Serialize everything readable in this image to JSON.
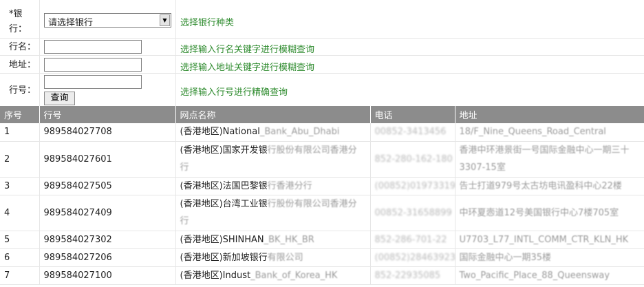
{
  "form": {
    "bank": {
      "label_star": "*银",
      "label_rest": "行：",
      "selected": "请选择银行",
      "hint": "选择银行种类"
    },
    "branch_name": {
      "label": "行名：",
      "value": "",
      "hint": "选择输入行名关键字进行模糊查询"
    },
    "address": {
      "label": "地址：",
      "value": "",
      "hint": "选择输入地址关键字进行模糊查询"
    },
    "bank_no": {
      "label": "行号：",
      "value": "",
      "hint": "选择输入行号进行精确查询"
    },
    "search_label": "查询"
  },
  "table": {
    "headers": [
      "序号",
      "行号",
      "网点名称",
      "电话",
      "地址"
    ],
    "rows": [
      {
        "idx": "1",
        "code": "989584027708",
        "name_a": "(香港地区)National",
        "name_b": "_Bank_Abu_Dhabi",
        "phone": "00852-3413456",
        "addr_a": "18/F_Nine_Queens_Road_Central",
        "addr_b": ""
      },
      {
        "idx": "2",
        "code": "989584027601",
        "name_a": "(香港地区)国家开发银",
        "name_b": "行股份有限公司香港分行",
        "phone": "852-280-162-180",
        "addr_a": "香港中环港景街一号国际金融中心一期三十",
        "addr_b": "3307-15室"
      },
      {
        "idx": "3",
        "code": "989584027505",
        "name_a": "(香港地区)法国巴黎银",
        "name_b": "行香港分行",
        "phone": "(00852)01973319",
        "addr_a": "告士打道979号太古坊电讯盈科中心22楼",
        "addr_b": ""
      },
      {
        "idx": "4",
        "code": "989584027409",
        "name_a": "(香港地区)台湾工业银",
        "name_b": "行股份有限公司香港分行",
        "phone": "00852-31658899",
        "addr_a": "中环夏悫道12号美国银行中心7楼705室",
        "addr_b": ""
      },
      {
        "idx": "5",
        "code": "989584027302",
        "name_a": "(香港地区)SHINHAN",
        "name_b": "_BK_HK_BR",
        "phone": "852-286-701-22",
        "addr_a": "U7703_L77_INTL_COMM_CTR_KLN_HK",
        "addr_b": ""
      },
      {
        "idx": "6",
        "code": "989584027206",
        "name_a": "(香港地区)新加坡银行",
        "name_b": "有限公司",
        "phone": "(00852)28463923",
        "addr_a": "国际金融中心一期35楼",
        "addr_b": ""
      },
      {
        "idx": "7",
        "code": "989584027100",
        "name_a": "(香港地区)Indust",
        "name_b": "_Bank_of_Korea_HK",
        "phone": "852-22935085",
        "addr_a": "Two_Pacific_Place_88_Queensway",
        "addr_b": ""
      }
    ]
  }
}
